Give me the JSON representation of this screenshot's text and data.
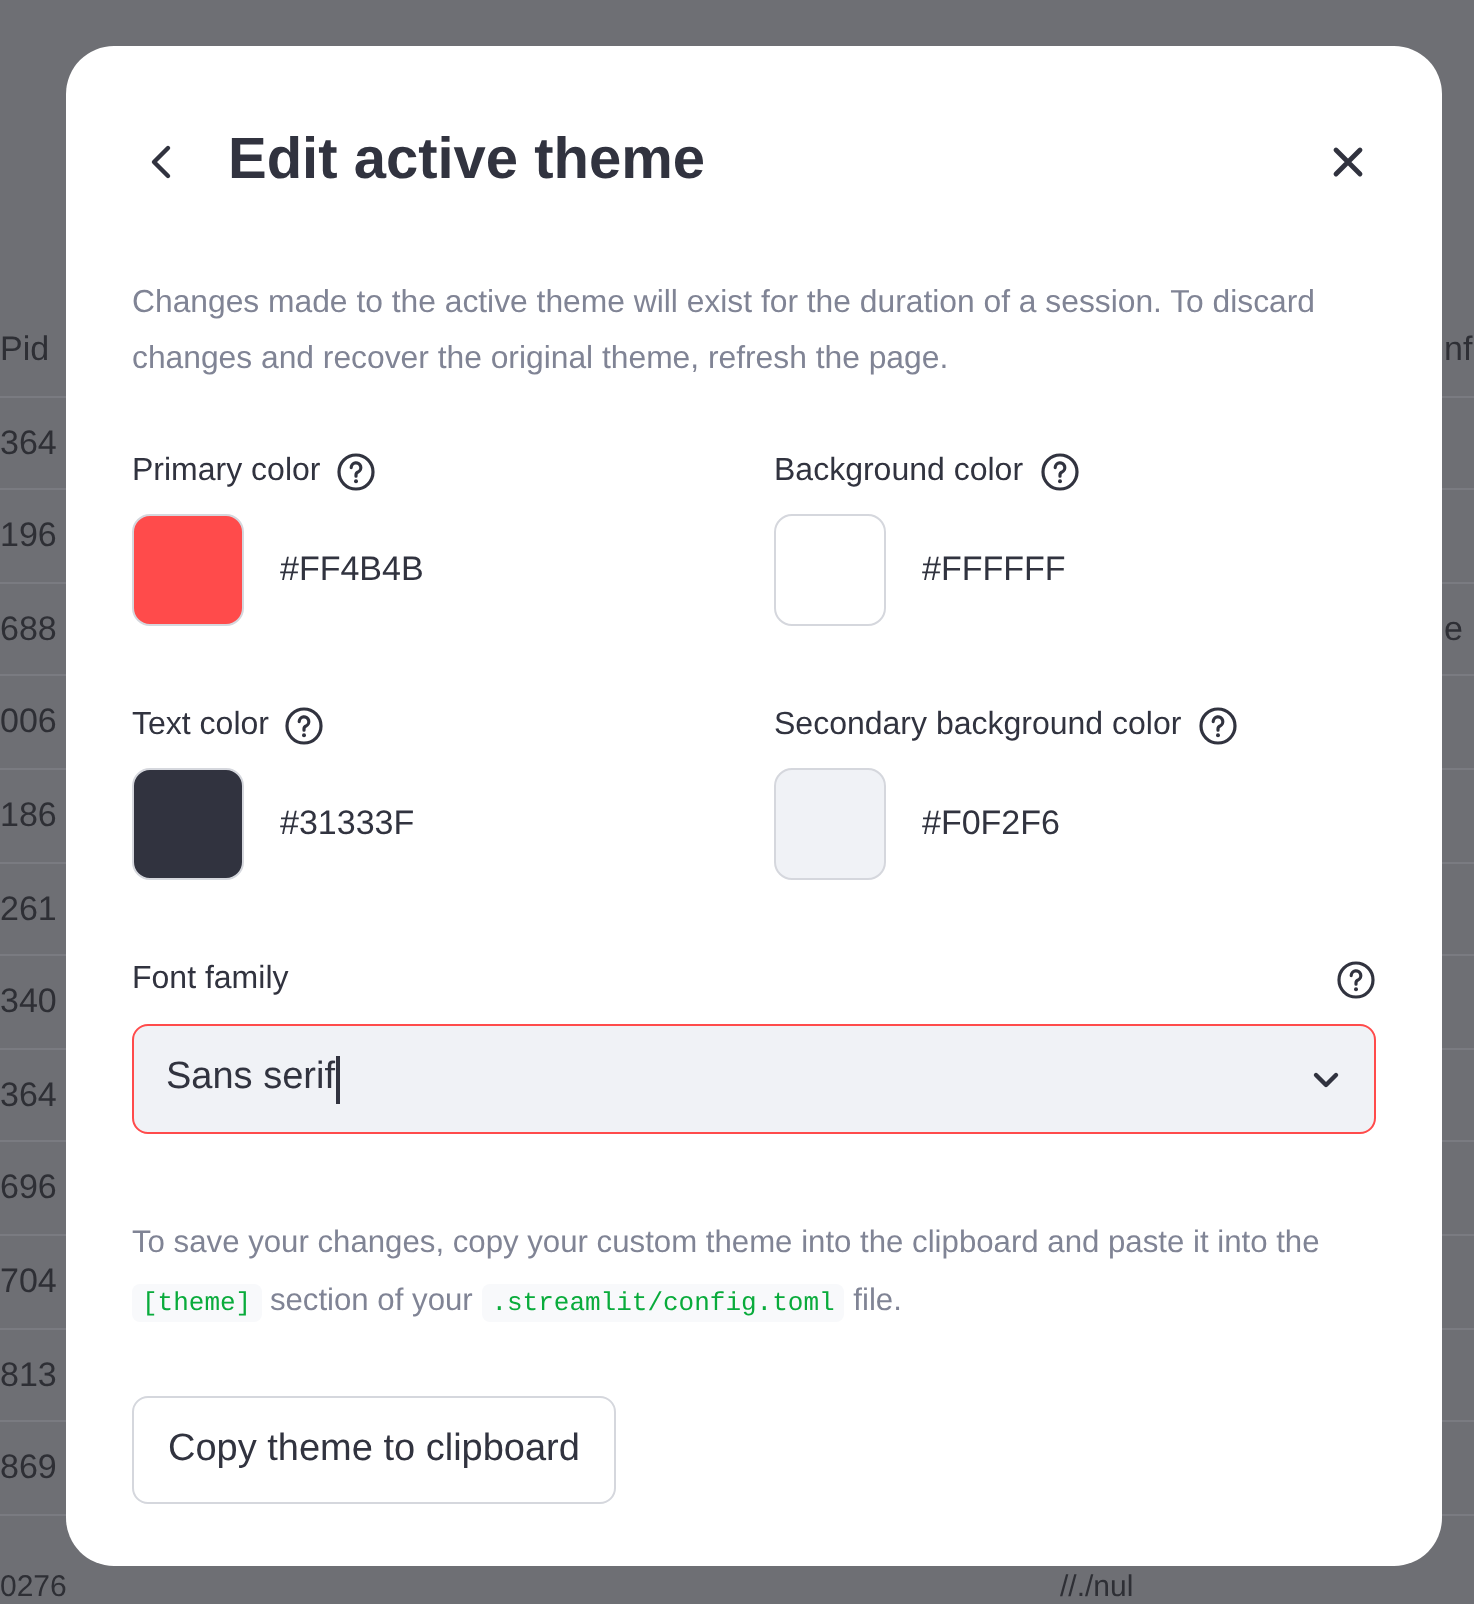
{
  "background_table": {
    "rows": [
      {
        "cell_first": "Pid",
        "cell_last": "nf"
      },
      {
        "cell_first": "364"
      },
      {
        "cell_first": "196"
      },
      {
        "cell_first": "688",
        "cell_last": "e"
      },
      {
        "cell_first": "006"
      },
      {
        "cell_first": "186"
      },
      {
        "cell_first": "261"
      },
      {
        "cell_first": "340"
      },
      {
        "cell_first": "364"
      },
      {
        "cell_first": "696"
      },
      {
        "cell_first": "704"
      },
      {
        "cell_first": "813"
      },
      {
        "cell_first": "869"
      },
      {
        "cell_first": "0276",
        "cell_middle": "//./nul"
      }
    ]
  },
  "dialog": {
    "title": "Edit active theme",
    "description": "Changes made to the active theme will exist for the duration of a session. To discard changes and recover the original theme, refresh the page.",
    "colors": [
      {
        "label": "Primary color",
        "value": "#FF4B4B",
        "color": "#ff4b4b"
      },
      {
        "label": "Background color",
        "value": "#FFFFFF",
        "color": "#ffffff"
      },
      {
        "label": "Text color",
        "value": "#31333F",
        "color": "#31333f"
      },
      {
        "label": "Secondary background color",
        "value": "#F0F2F6",
        "color": "#f0f2f6"
      }
    ],
    "font_family": {
      "label": "Font family",
      "value": "Sans serif",
      "focused": true
    },
    "instructions": [
      {
        "kind": "text",
        "text": "To save your changes, copy your custom theme into the clipboard and paste it into the "
      },
      {
        "kind": "code",
        "text": "[theme]"
      },
      {
        "kind": "text",
        "text": " section of your "
      },
      {
        "kind": "code",
        "text": ".streamlit/config.toml"
      },
      {
        "kind": "text",
        "text": " file."
      }
    ],
    "button": "Copy theme to clipboard"
  }
}
